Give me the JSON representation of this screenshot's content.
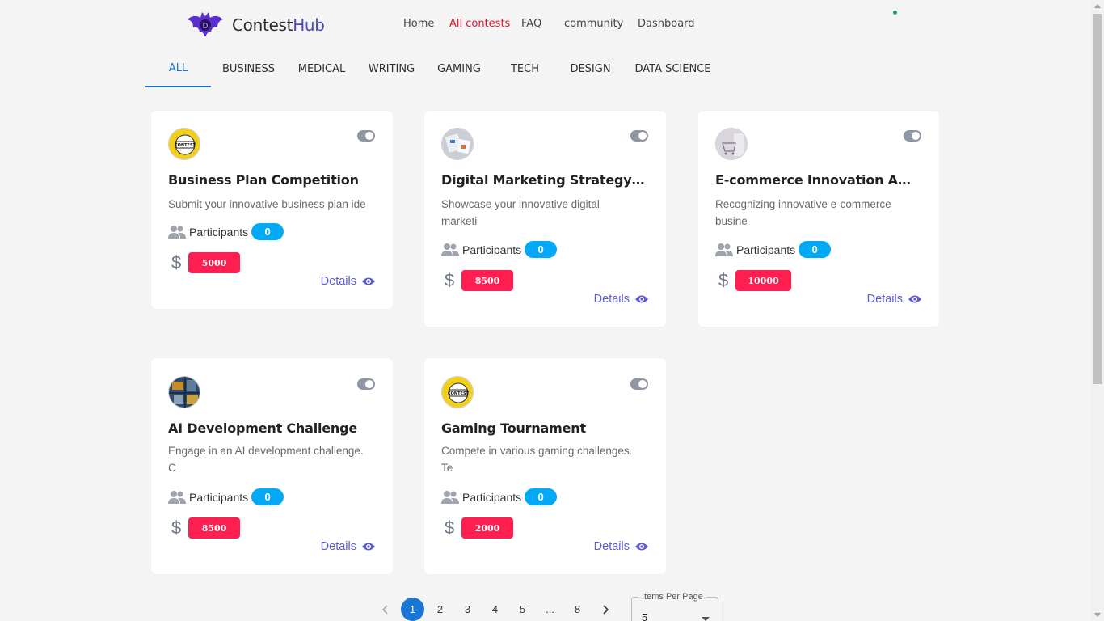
{
  "brand": {
    "name_part1": "Contest",
    "name_part2": "Hub"
  },
  "nav": [
    {
      "label": "Home",
      "active": false
    },
    {
      "label": "All contests",
      "active": true
    },
    {
      "label": "FAQ",
      "active": false
    },
    {
      "label": "community",
      "active": false
    },
    {
      "label": "Dashboard",
      "active": false
    }
  ],
  "tabs": [
    "ALL",
    "BUSINESS",
    "MEDICAL",
    "WRITING",
    "GAMING",
    "TECH",
    "DESIGN",
    "DATA SCIENCE"
  ],
  "active_tab": "ALL",
  "cards": [
    {
      "title": "Business Plan Competition",
      "desc": "Submit your innovative business plan ide",
      "participants_label": "Participants",
      "participants": "0",
      "prize": "5000",
      "details_label": "Details",
      "avatar_icon": "contest-badge-icon"
    },
    {
      "title": "Digital Marketing Strategy Com...",
      "desc": "Showcase your innovative digital marketi",
      "participants_label": "Participants",
      "participants": "0",
      "prize": "8500",
      "details_label": "Details",
      "avatar_icon": "marketing-photo-icon"
    },
    {
      "title": "E-commerce Innovation Awards",
      "desc": "Recognizing innovative e-commerce busine",
      "participants_label": "Participants",
      "participants": "0",
      "prize": "10000",
      "details_label": "Details",
      "avatar_icon": "shopping-cart-photo-icon"
    },
    {
      "title": "AI Development Challenge",
      "desc": "Engage in an AI development challenge. C",
      "participants_label": "Participants",
      "participants": "0",
      "prize": "8500",
      "details_label": "Details",
      "avatar_icon": "circuit-board-photo-icon"
    },
    {
      "title": "Gaming Tournament",
      "desc": "Compete in various gaming challenges. Te",
      "participants_label": "Participants",
      "participants": "0",
      "prize": "2000",
      "details_label": "Details",
      "avatar_icon": "contest-badge-icon"
    }
  ],
  "pagination": {
    "pages": [
      "1",
      "2",
      "3",
      "4",
      "5",
      "...",
      "8"
    ],
    "current": "1"
  },
  "items_per_page": {
    "label": "Items Per Page",
    "value": "5"
  },
  "colors": {
    "accent": "#1976d2",
    "nav_active": "#e3122a",
    "prize": "#ff1e50",
    "participants_pill": "#03a9f4",
    "details": "#5b5bd6"
  }
}
